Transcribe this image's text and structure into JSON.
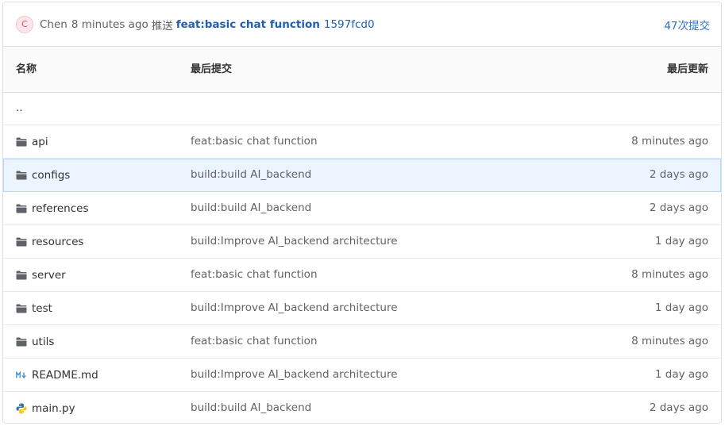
{
  "commit_bar": {
    "avatar_letter": "C",
    "author": "Chen",
    "time": "8 minutes ago",
    "verb": "推送",
    "message": "feat:basic chat function",
    "sha": "1597fcd0",
    "commit_count": "47次提交"
  },
  "table": {
    "headers": {
      "name": "名称",
      "last_commit": "最后提交",
      "last_updated": "最后更新"
    },
    "parent_dir": "..",
    "rows": [
      {
        "name": "api",
        "icon": "folder-icon",
        "commit": "feat:basic chat function",
        "time": "8 minutes ago"
      },
      {
        "name": "configs",
        "icon": "folder-icon",
        "commit": "build:build AI_backend",
        "time": "2 days ago"
      },
      {
        "name": "references",
        "icon": "folder-icon",
        "commit": "build:build AI_backend",
        "time": "2 days ago"
      },
      {
        "name": "resources",
        "icon": "folder-icon",
        "commit": "build:Improve AI_backend architecture",
        "time": "1 day ago"
      },
      {
        "name": "server",
        "icon": "folder-icon",
        "commit": "feat:basic chat function",
        "time": "8 minutes ago"
      },
      {
        "name": "test",
        "icon": "folder-icon",
        "commit": "build:Improve AI_backend architecture",
        "time": "1 day ago"
      },
      {
        "name": "utils",
        "icon": "folder-icon",
        "commit": "feat:basic chat function",
        "time": "8 minutes ago"
      },
      {
        "name": "README.md",
        "icon": "markdown-icon",
        "commit": "build:Improve AI_backend architecture",
        "time": "1 day ago"
      },
      {
        "name": "main.py",
        "icon": "python-icon",
        "commit": "build:build AI_backend",
        "time": "2 days ago"
      }
    ]
  },
  "colors": {
    "link": "#1f5fb5",
    "highlight_row": "#ecf5ff",
    "border": "#dcdfe6"
  }
}
